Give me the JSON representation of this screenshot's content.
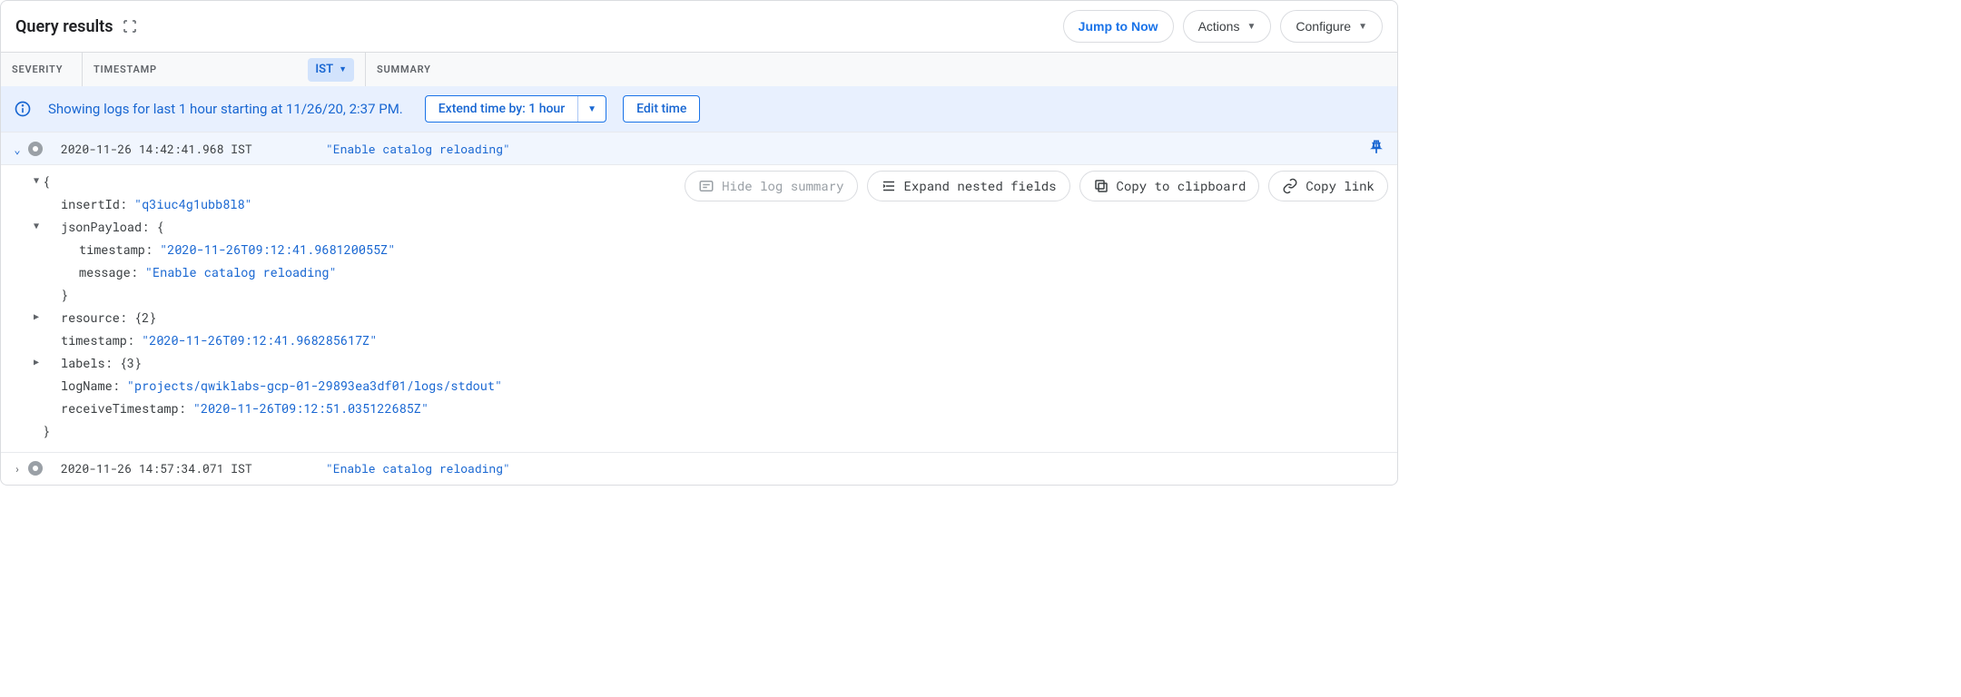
{
  "header": {
    "title": "Query results",
    "jump_to_now": "Jump to Now",
    "actions": "Actions",
    "configure": "Configure"
  },
  "columns": {
    "severity": "SEVERITY",
    "timestamp": "TIMESTAMP",
    "tz": "IST",
    "summary": "SUMMARY"
  },
  "infobar": {
    "text": "Showing logs for last 1 hour starting at 11/26/20, 2:37 PM.",
    "extend_label": "Extend time by: 1 hour",
    "edit_time": "Edit time"
  },
  "detail_buttons": {
    "hide": "Hide log summary",
    "expand_nested": "Expand nested fields",
    "copy_clipboard": "Copy to clipboard",
    "copy_link": "Copy link"
  },
  "logs": [
    {
      "expanded": true,
      "timestamp": "2020-11-26 14:42:41.968 IST",
      "summary": "\"Enable catalog reloading\"",
      "detail": {
        "insertId": {
          "key": "insertId:",
          "value": "\"q3iuc4g1ubb8l8\""
        },
        "jsonPayload": {
          "key": "jsonPayload:",
          "open": "{",
          "timestamp": {
            "key": "timestamp:",
            "value": "\"2020-11-26T09:12:41.968120055Z\""
          },
          "message": {
            "key": "message:",
            "value": "\"Enable catalog reloading\""
          },
          "close": "}"
        },
        "resource": {
          "key": "resource:",
          "count": "{2}"
        },
        "timestamp": {
          "key": "timestamp:",
          "value": "\"2020-11-26T09:12:41.968285617Z\""
        },
        "labels": {
          "key": "labels:",
          "count": "{3}"
        },
        "logName": {
          "key": "logName:",
          "value": "\"projects/qwiklabs-gcp-01-29893ea3df01/logs/stdout\""
        },
        "receiveTimestamp": {
          "key": "receiveTimestamp:",
          "value": "\"2020-11-26T09:12:51.035122685Z\""
        },
        "open": "{",
        "close": "}"
      }
    },
    {
      "expanded": false,
      "timestamp": "2020-11-26 14:57:34.071 IST",
      "summary": "\"Enable catalog reloading\""
    }
  ]
}
